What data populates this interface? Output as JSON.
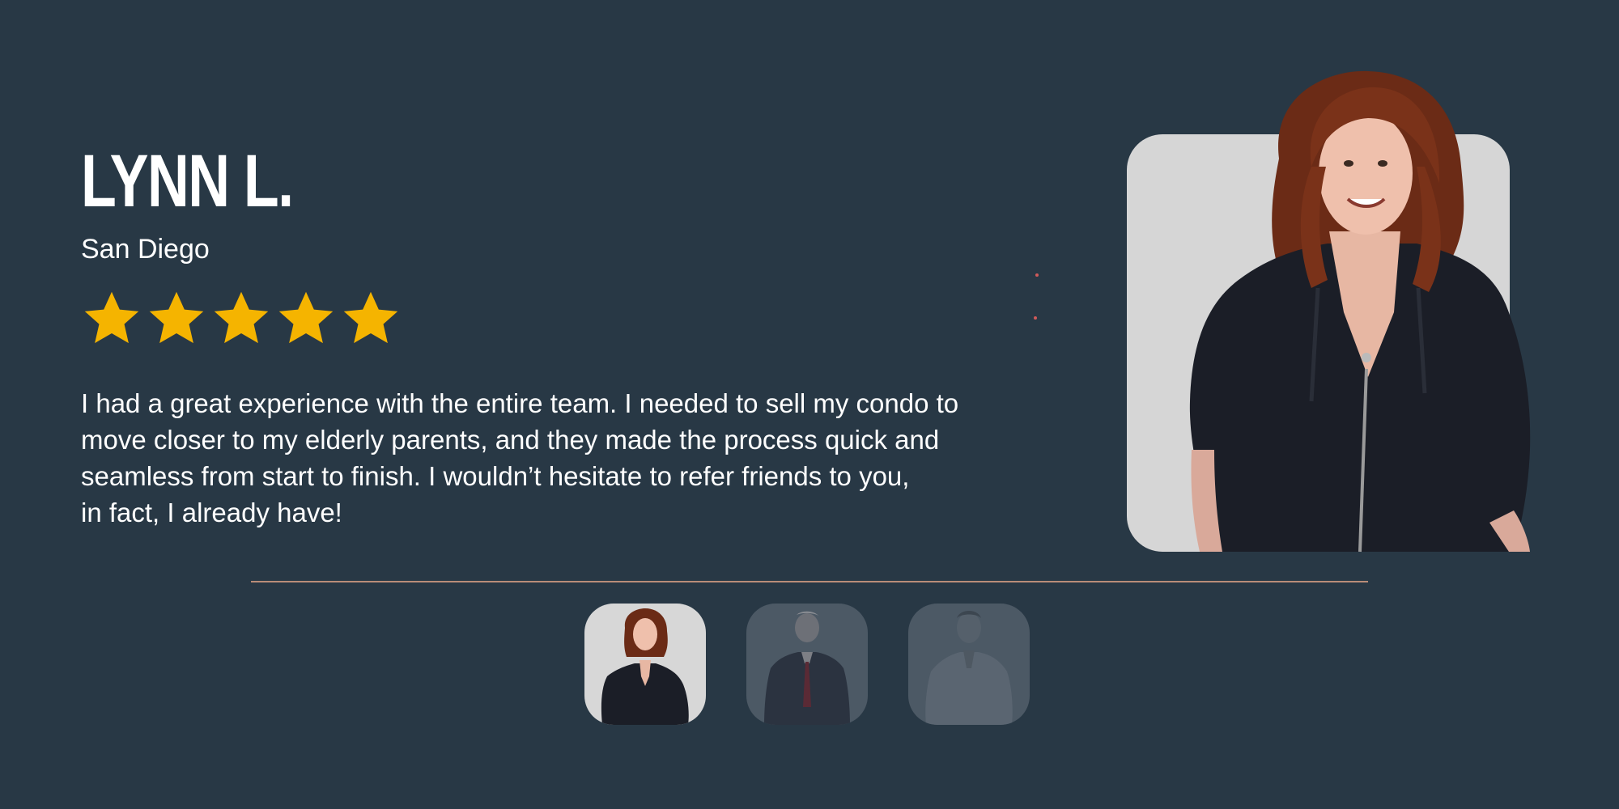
{
  "testimonial": {
    "name": "LYNN L.",
    "location": "San Diego",
    "rating": 5,
    "rating_max": 5,
    "quote_lines": [
      "I had a great experience with the entire team. I needed to sell my condo to",
      "move closer to my elderly parents, and they made the process quick and",
      "seamless from start to finish. I wouldn’t hesitate to refer friends to you,",
      "in fact, I already have!"
    ]
  },
  "thumbnails": [
    {
      "label": "woman-with-red-hair",
      "active": true
    },
    {
      "label": "man-in-suit",
      "active": false
    },
    {
      "label": "man-in-white-shirt",
      "active": false
    }
  ],
  "colors": {
    "background": "#283845",
    "star": "#f5b400",
    "divider": "#b98c78",
    "photo_bg": "#d6d6d6"
  },
  "icons": {
    "star": "star-icon"
  }
}
